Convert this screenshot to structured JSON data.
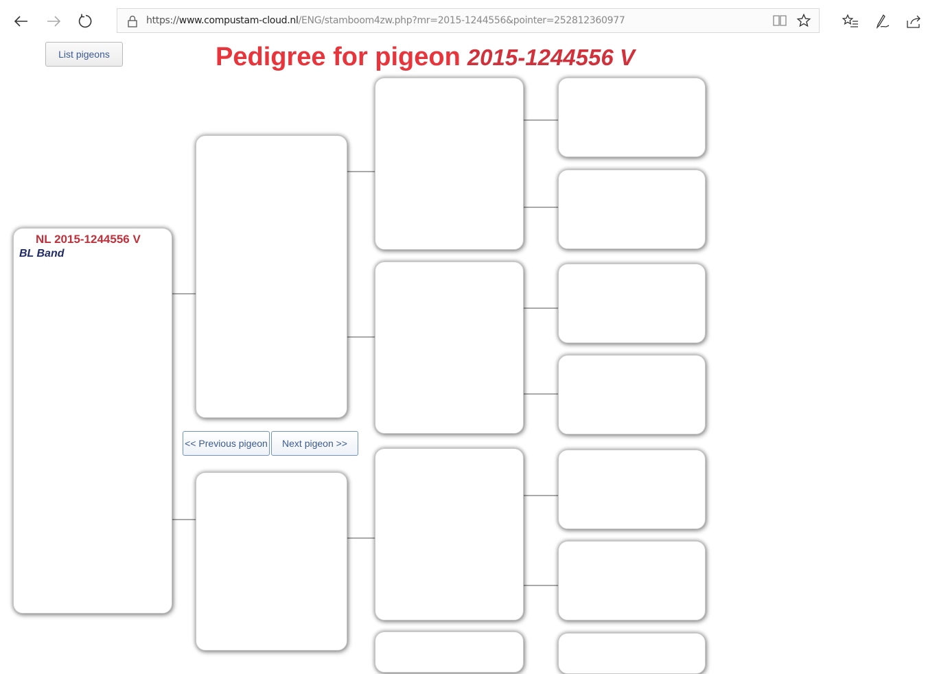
{
  "browser": {
    "url_prefix": "https://",
    "url_host": "www.compustam-cloud.nl",
    "url_path": "/ENG/stamboom4zw.php?mr=2015-1244556&pointer=252812360977",
    "icons": [
      "back-icon",
      "forward-icon",
      "refresh-icon",
      "lock-icon",
      "reading-view-icon",
      "favorite-star-icon",
      "favorites-list-icon",
      "pen-icon",
      "share-icon"
    ]
  },
  "page": {
    "list_button": "List pigeons",
    "title_text": "Pedigree for pigeon",
    "title_ring": "2015-1244556 V",
    "prev_button": "<< Previous pigeon",
    "next_button": "Next pigeon >>"
  },
  "pigeon": {
    "ring": "NL 2015-1244556 V",
    "color": "BL Band"
  },
  "colors": {
    "title": "#e8343b",
    "ring": "#c0303b",
    "color_text": "#1f2a66",
    "button_text": "#3b5a94"
  }
}
